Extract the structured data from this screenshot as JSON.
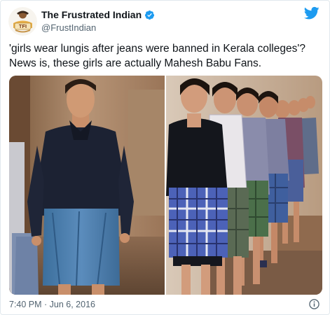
{
  "tweet": {
    "author_name": "The Frustrated Indian",
    "author_handle": "@FrustIndian",
    "avatar_text": "TFI",
    "text_line1": "'girls wear lungis after jeans were banned in Kerala colleges'?",
    "text_line2": "News is, these girls are actually Mahesh Babu Fans.",
    "timestamp": "7:40 PM · Jun 6, 2016",
    "brand_color": "#1d9bf0",
    "icons": [
      "verified-badge-icon",
      "twitter-bird-icon",
      "info-icon"
    ]
  },
  "media": {
    "photos": [
      "photo-man-in-lungi",
      "photo-girls-in-lungis"
    ]
  }
}
